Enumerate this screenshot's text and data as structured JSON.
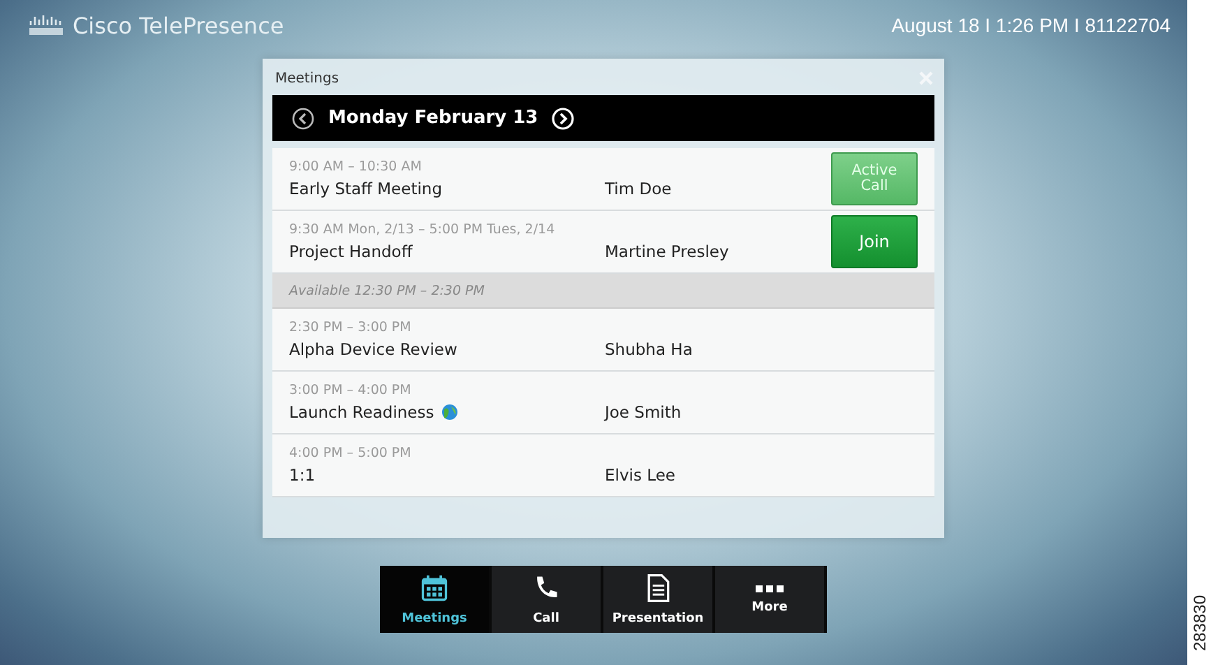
{
  "header": {
    "brand": "Cisco TelePresence",
    "status": "August 18 I 1:26 PM I 81122704"
  },
  "dialog": {
    "title": "Meetings",
    "date": "Monday February 13",
    "items": [
      {
        "kind": "meeting",
        "time": "9:00 AM – 10:30 AM",
        "title": "Early Staff Meeting",
        "organizer": "Tim Doe",
        "globe": false,
        "action": {
          "kind": "active",
          "label": "Active Call"
        }
      },
      {
        "kind": "meeting",
        "time": "9:30 AM Mon, 2/13 – 5:00 PM Tues, 2/14",
        "title": "Project Handoff",
        "organizer": "Martine Presley",
        "globe": false,
        "action": {
          "kind": "join",
          "label": "Join"
        }
      },
      {
        "kind": "available",
        "text": "Available 12:30 PM – 2:30 PM"
      },
      {
        "kind": "meeting",
        "time": "2:30 PM – 3:00 PM",
        "title": "Alpha Device Review",
        "organizer": "Shubha Ha",
        "globe": false
      },
      {
        "kind": "meeting",
        "time": "3:00 PM – 4:00 PM",
        "title": "Launch Readiness",
        "organizer": "Joe Smith",
        "globe": true
      },
      {
        "kind": "meeting",
        "time": "4:00 PM – 5:00 PM",
        "title": "1:1",
        "organizer": "Elvis Lee",
        "globe": false
      }
    ]
  },
  "toolbar": [
    {
      "kind": "calendar",
      "label": "Meetings",
      "selected": true
    },
    {
      "kind": "phone",
      "label": "Call",
      "selected": false
    },
    {
      "kind": "document",
      "label": "Presentation",
      "selected": false
    },
    {
      "kind": "dots",
      "label": "More",
      "selected": false
    }
  ],
  "figure_number": "283830"
}
